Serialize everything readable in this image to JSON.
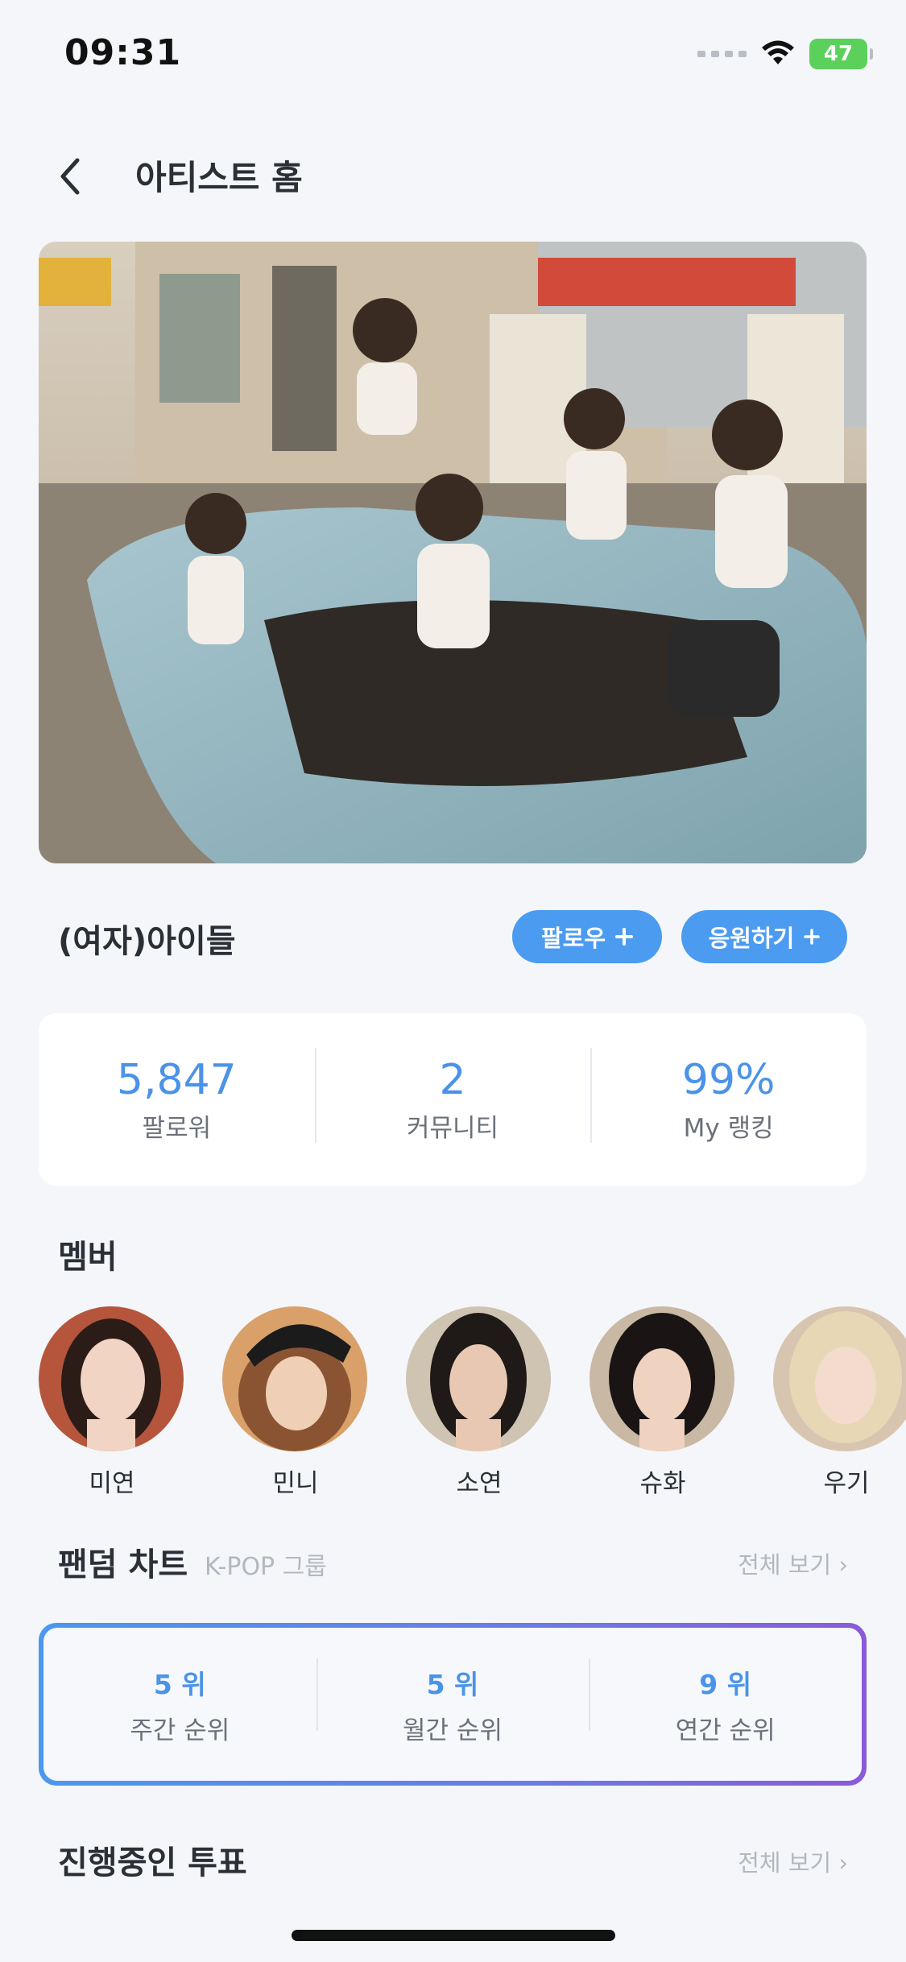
{
  "status_bar": {
    "time": "09:31",
    "battery": "47"
  },
  "header": {
    "title": "아티스트 홈"
  },
  "artist": {
    "name": "(여자)아이들",
    "follow_label": "팔로우",
    "cheer_label": "응원하기"
  },
  "stats": [
    {
      "value": "5,847",
      "label": "팔로워"
    },
    {
      "value": "2",
      "label": "커뮤니티"
    },
    {
      "value": "99%",
      "label": "My 랭킹"
    }
  ],
  "members_section": {
    "title": "멤버",
    "members": [
      {
        "name": "미연"
      },
      {
        "name": "민니"
      },
      {
        "name": "소연"
      },
      {
        "name": "슈화"
      },
      {
        "name": "우기"
      }
    ]
  },
  "fandom_chart": {
    "title": "팬덤 차트",
    "subtitle": "K-POP 그룹",
    "see_all": "전체 보기 ›",
    "ranks": [
      {
        "value": "5 위",
        "label": "주간 순위"
      },
      {
        "value": "5 위",
        "label": "월간 순위"
      },
      {
        "value": "9 위",
        "label": "연간 순위"
      }
    ]
  },
  "votes_section": {
    "title": "진행중인 투표",
    "see_all": "전체 보기 ›"
  },
  "colors": {
    "accent": "#4b9bf0",
    "background": "#f4f6f9",
    "gradient_start": "#4a98f0",
    "gradient_end": "#8a5ad9"
  }
}
